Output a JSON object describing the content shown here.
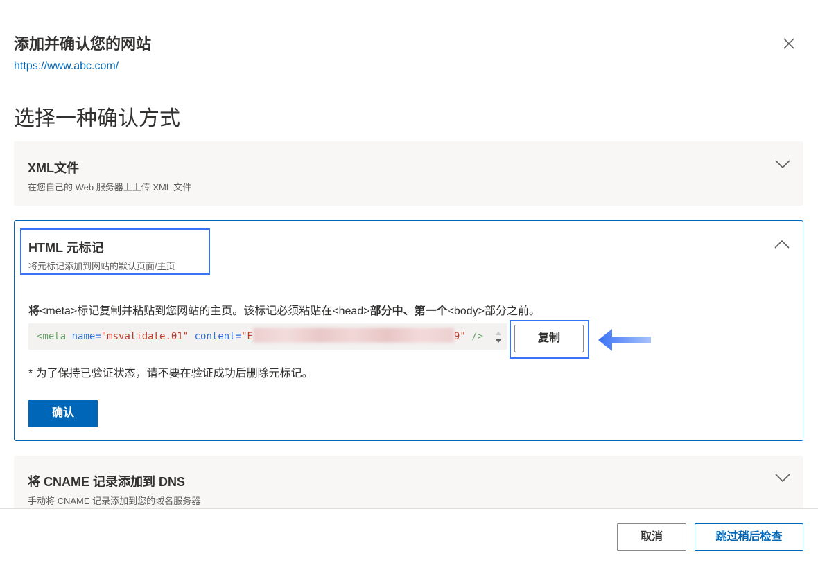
{
  "dialog": {
    "title": "添加并确认您的网站",
    "site_url": "https://www.abc.com/",
    "close_icon": "close-icon"
  },
  "main": {
    "heading": "选择一种确认方式"
  },
  "options": {
    "xml": {
      "title": "XML文件",
      "subtitle": "在您自己的 Web 服务器上上传 XML 文件",
      "expanded": false
    },
    "html_meta": {
      "title": "HTML 元标记",
      "subtitle": "将元标记添加到网站的默认页面/主页",
      "expanded": true,
      "instruction": {
        "p1": "将",
        "p2": "<meta>标记复制并粘贴到您网站的主页。该标记必须粘贴在<head>",
        "p3": "部分中、第一个",
        "p4": "<body>部分之前。"
      },
      "code": {
        "open": "<meta",
        "name_attr": "name=",
        "name_value": "\"msvalidate.01\"",
        "content_attr": "content=",
        "content_start": "\"E",
        "content_end": "9\"",
        "close": "/>"
      },
      "copy_label": "复制",
      "note": "* 为了保持已验证状态，请不要在验证成功后删除元标记。",
      "confirm_label": "确认"
    },
    "cname": {
      "title": "将 CNAME 记录添加到 DNS",
      "subtitle": "手动将 CNAME 记录添加到您的域名服务器",
      "expanded": false
    }
  },
  "footer": {
    "cancel_label": "取消",
    "skip_label": "跳过稍后检查"
  },
  "colors": {
    "accent": "#0067b8",
    "highlight": "#3b73f6",
    "panel_bg": "#f8f7f6"
  }
}
